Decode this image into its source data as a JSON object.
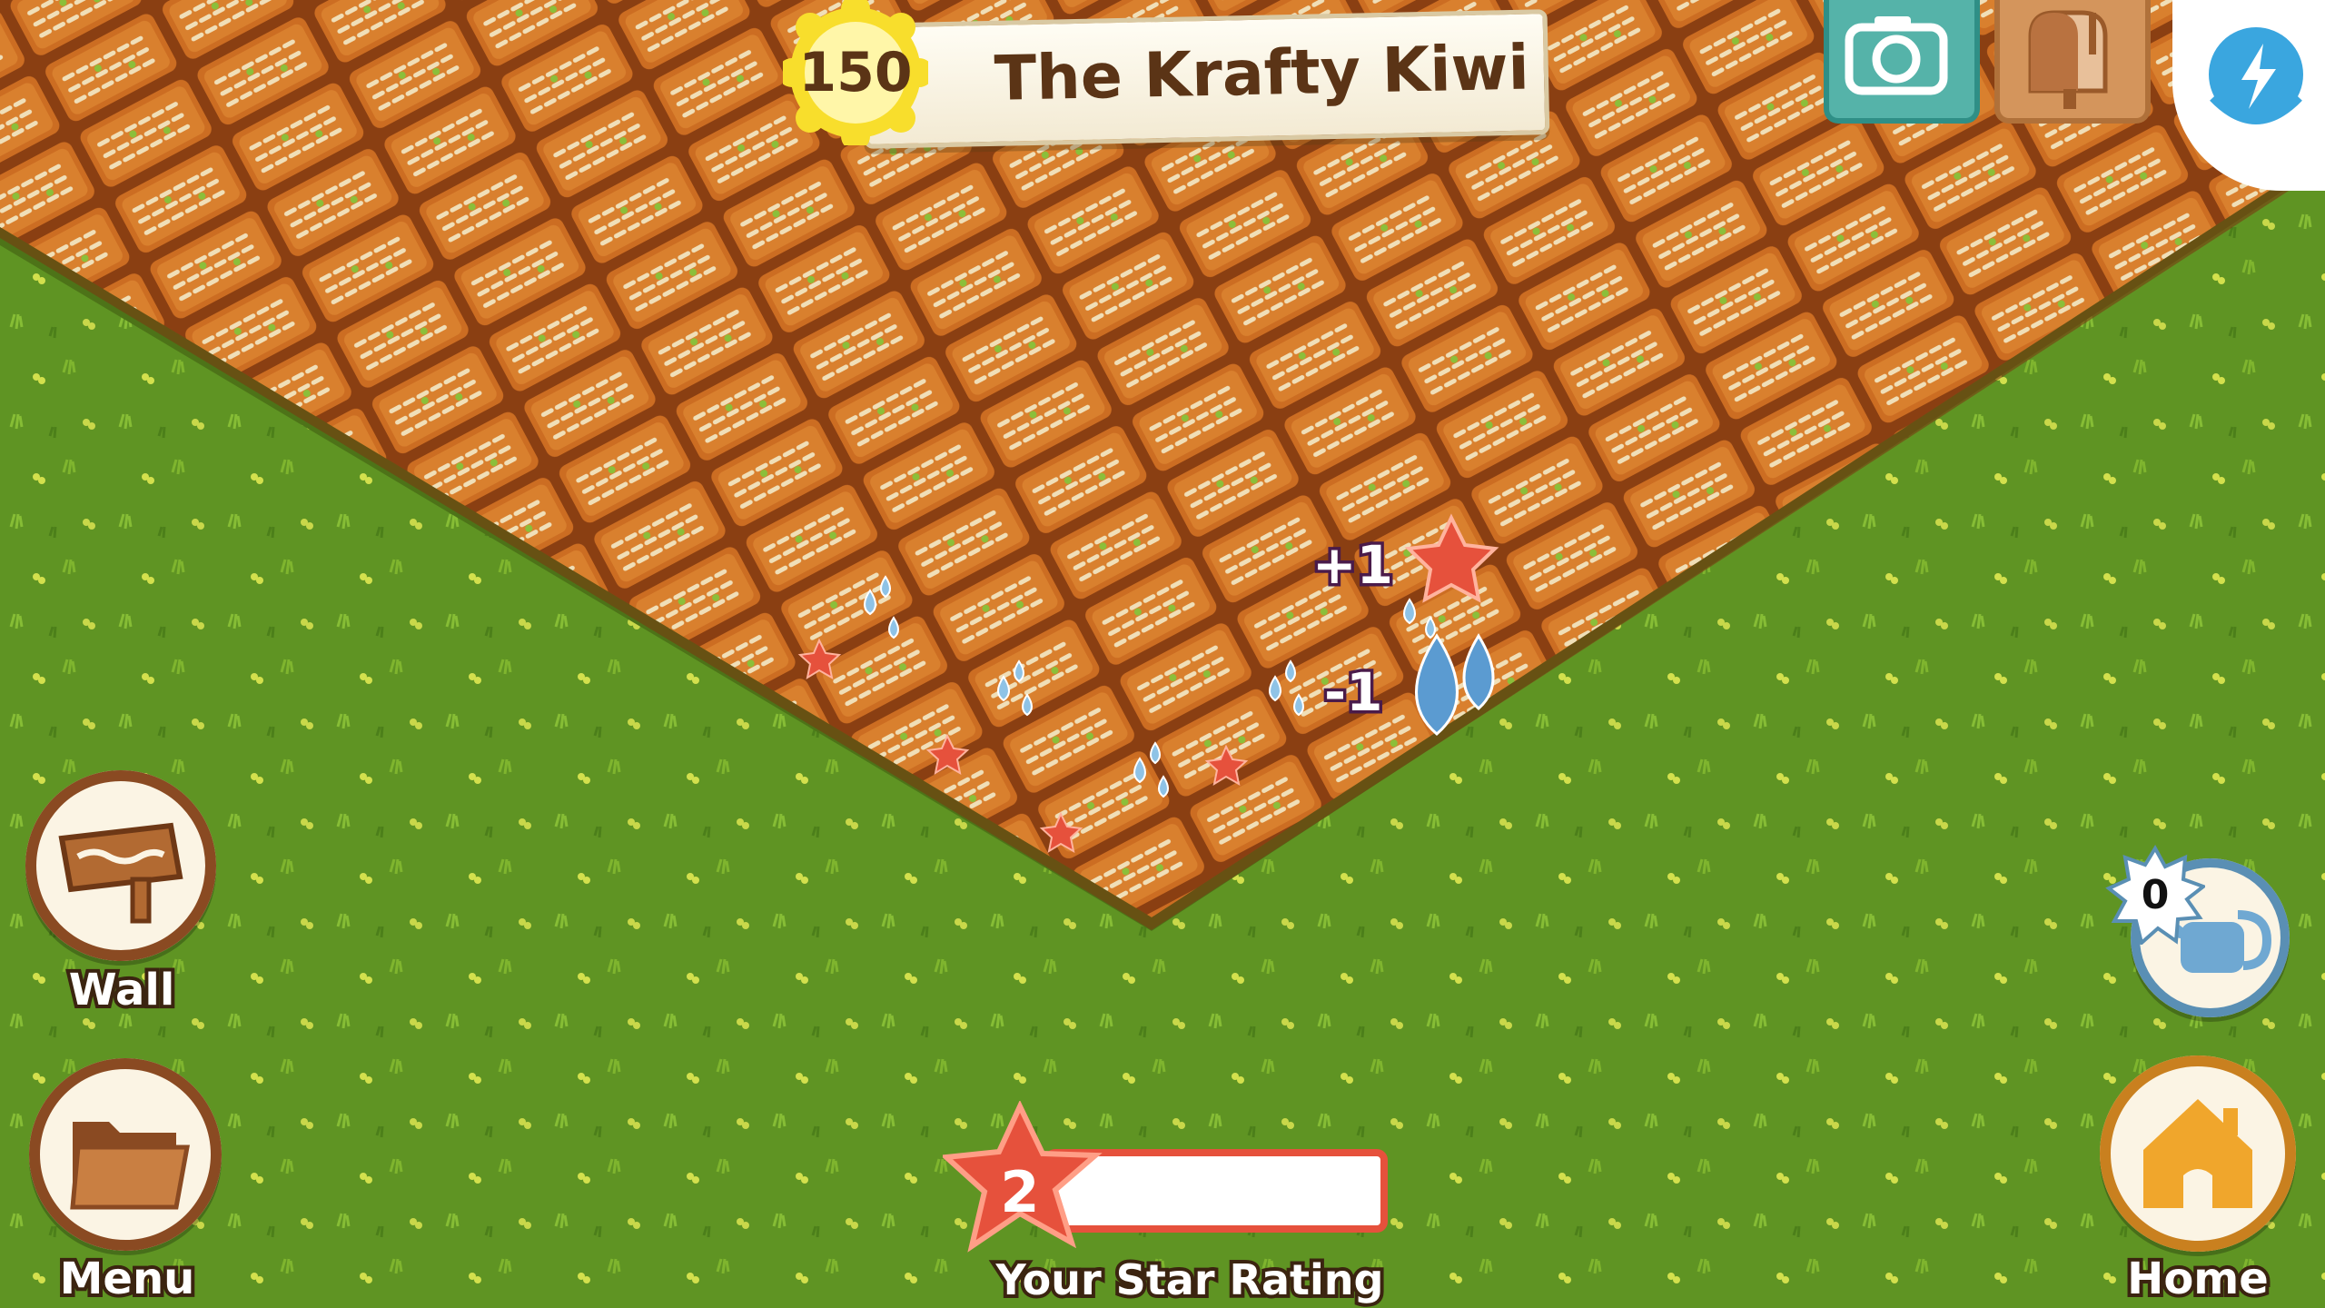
{
  "header": {
    "coins": "150",
    "farm_name": "The Krafty Kiwi"
  },
  "top_right": {
    "camera_icon": "camera-icon",
    "mailbox_icon": "mailbox-icon",
    "power_icon": "lightning-icon"
  },
  "left_buttons": {
    "wall_label": "Wall",
    "menu_label": "Menu"
  },
  "right_buttons": {
    "home_label": "Home",
    "watering_can_count": "0"
  },
  "star_rating": {
    "value": "2",
    "label": "Your Star Rating",
    "progress_fraction": 0.0
  },
  "feedback": {
    "star_gain": "+1",
    "water_loss": "-1"
  },
  "colors": {
    "grass": "#5f9423",
    "soil": "#c4661f",
    "coin": "#f8de2c",
    "star": "#e6513c",
    "water": "#5b9bd1"
  }
}
